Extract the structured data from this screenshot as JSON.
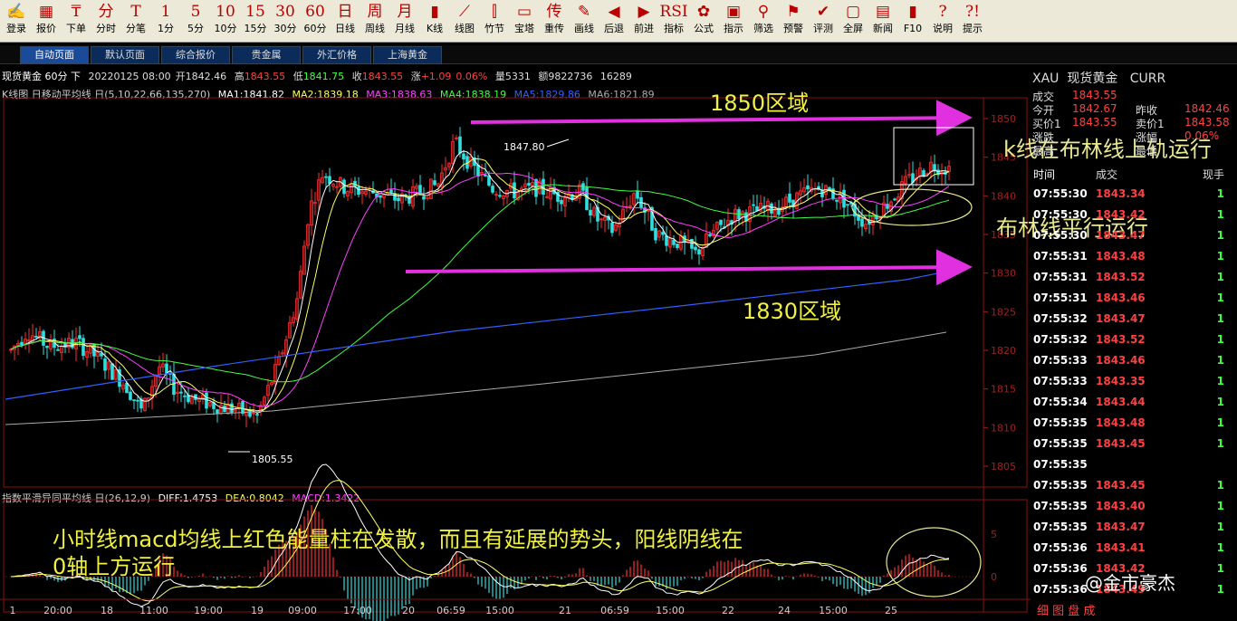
{
  "toolbar": {
    "items": [
      {
        "icon": "✍",
        "label": "登录"
      },
      {
        "icon": "▦",
        "label": "报价"
      },
      {
        "icon": "₸",
        "label": "下单"
      },
      {
        "icon": "分",
        "label": "分时"
      },
      {
        "icon": "T",
        "label": "分笔"
      },
      {
        "icon": "1",
        "label": "1分"
      },
      {
        "icon": "5",
        "label": "5分"
      },
      {
        "icon": "10",
        "label": "10分"
      },
      {
        "icon": "15",
        "label": "15分"
      },
      {
        "icon": "30",
        "label": "30分"
      },
      {
        "icon": "60",
        "label": "60分"
      },
      {
        "icon": "日",
        "label": "日线"
      },
      {
        "icon": "周",
        "label": "周线"
      },
      {
        "icon": "月",
        "label": "月线"
      },
      {
        "icon": "▮",
        "label": "K线"
      },
      {
        "icon": "⟋",
        "label": "线图"
      },
      {
        "icon": "⫿",
        "label": "竹节"
      },
      {
        "icon": "▭",
        "label": "宝塔"
      },
      {
        "icon": "传",
        "label": "重传"
      },
      {
        "icon": "✎",
        "label": "画线"
      },
      {
        "icon": "◀",
        "label": "后退"
      },
      {
        "icon": "▶",
        "label": "前进"
      },
      {
        "icon": "RSI",
        "label": "指标"
      },
      {
        "icon": "✿",
        "label": "公式"
      },
      {
        "icon": "▣",
        "label": "指示"
      },
      {
        "icon": "⚲",
        "label": "筛选"
      },
      {
        "icon": "⚑",
        "label": "预警"
      },
      {
        "icon": "✔",
        "label": "评测"
      },
      {
        "icon": "▢",
        "label": "全屏"
      },
      {
        "icon": "▤",
        "label": "新闻"
      },
      {
        "icon": "▮",
        "label": "F10"
      },
      {
        "icon": "?",
        "label": "说明"
      },
      {
        "icon": "?!",
        "label": "提示"
      }
    ]
  },
  "tabs": [
    "自动页面",
    "默认页面",
    "综合报价",
    "贵金属",
    "外汇价格",
    "上海黄金"
  ],
  "info": {
    "title": "现货黄金 60分 下",
    "date": "20220125 08:00",
    "open": "开1842.46",
    "high_label": "高",
    "high": "1843.55",
    "low_label": "低",
    "low": "1841.75",
    "close_label": "收",
    "close": "1843.55",
    "change_label": "涨",
    "change": "+1.09",
    "change_pct": "0.06%",
    "volume": "量5331",
    "amount": "额9822736",
    "extra": "16289"
  },
  "ma": {
    "title": "K线图 日移动平均线 日(5,10,22,66,135,270)",
    "ma1": "MA1:1841.82",
    "ma2": "MA2:1839.18",
    "ma3": "MA3:1838.63",
    "ma4": "MA4:1838.19",
    "ma5": "MA5:1829.86",
    "ma6": "MA6:1821.89"
  },
  "macd": {
    "title": "指数平滑异同平均线 日(26,12,9)",
    "diff": "DIFF:1.4753",
    "dea": "DEA:0.8042",
    "macd": "MACD:1.3422"
  },
  "annotations": {
    "zone1850": "1850区域",
    "zone1830": "1830区域",
    "upper_rail": "k线在布林线上轨运行",
    "boll_flat": "布林线平行运行",
    "macd_note_line1": "小时线macd均线上红色能量柱在发散，而且有延展的势头，阳线阴线在",
    "macd_note_line2": "0轴上方运行"
  },
  "chart_data": {
    "type": "candlestick",
    "title": "现货黄金 60分",
    "price_axis": {
      "min": 1805,
      "max": 1850,
      "ticks": [
        1850,
        1845,
        1840,
        1835,
        1830,
        1825,
        1820,
        1815,
        1810,
        1805
      ]
    },
    "macd_axis": {
      "ticks": [
        5,
        0
      ]
    },
    "x_ticks": [
      "1",
      "20:00",
      "18",
      "11:00",
      "19:00",
      "19",
      "09:00",
      "17:00",
      "20",
      "06:59",
      "15:00",
      "21",
      "06:59",
      "15:00",
      "22",
      "24",
      "15:00",
      "25"
    ],
    "labels": {
      "high": "1847.80",
      "low": "1805.55"
    },
    "last_close": 1843.55,
    "colors": {
      "up": "#ff3030",
      "down": "#30e0e0",
      "ma1": "#ffffff",
      "ma2": "#ffff60",
      "ma3": "#ff40ff",
      "ma4": "#40ff40",
      "ma5": "#3060ff",
      "ma6": "#aaaaaa",
      "zone_arrow": "#e030e0"
    }
  },
  "quote": {
    "symbol": "XAU",
    "name": "现货黄金",
    "curr": "CURR",
    "rows": [
      {
        "label": "成交",
        "value": "1843.55"
      },
      {
        "label": "今开",
        "value": "1842.67",
        "label2": "昨收",
        "value2": "1842.46"
      },
      {
        "label": "买价1",
        "value": "1843.55",
        "label2": "卖价1",
        "value2": "1843.58"
      },
      {
        "label": "涨跌",
        "value": "",
        "label2": "涨幅",
        "value2": "0.06%"
      },
      {
        "label": "最高",
        "value": "",
        "label2": "最低",
        "value2": ""
      }
    ]
  },
  "ticks_header": {
    "time": "时间",
    "price": "成交",
    "vol": "现手"
  },
  "ticks": [
    {
      "t": "07:55:30",
      "p": "1843.34",
      "v": "1"
    },
    {
      "t": "07:55:30",
      "p": "1843.42",
      "v": "1"
    },
    {
      "t": "07:55:30",
      "p": "1843.47",
      "v": "1"
    },
    {
      "t": "07:55:31",
      "p": "1843.48",
      "v": "1"
    },
    {
      "t": "07:55:31",
      "p": "1843.52",
      "v": "1"
    },
    {
      "t": "07:55:31",
      "p": "1843.46",
      "v": "1"
    },
    {
      "t": "07:55:32",
      "p": "1843.47",
      "v": "1"
    },
    {
      "t": "07:55:32",
      "p": "1843.52",
      "v": "1"
    },
    {
      "t": "07:55:33",
      "p": "1843.46",
      "v": "1"
    },
    {
      "t": "07:55:33",
      "p": "1843.35",
      "v": "1"
    },
    {
      "t": "07:55:34",
      "p": "1843.44",
      "v": "1"
    },
    {
      "t": "07:55:35",
      "p": "1843.48",
      "v": "1"
    },
    {
      "t": "07:55:35",
      "p": "1843.45",
      "v": "1"
    },
    {
      "t": "07:55:35",
      "p": "",
      "v": ""
    },
    {
      "t": "07:55:35",
      "p": "1843.45",
      "v": "1"
    },
    {
      "t": "07:55:35",
      "p": "1843.40",
      "v": "1"
    },
    {
      "t": "07:55:35",
      "p": "1843.47",
      "v": "1"
    },
    {
      "t": "07:55:36",
      "p": "1843.41",
      "v": "1"
    },
    {
      "t": "07:55:36",
      "p": "1843.42",
      "v": "1"
    },
    {
      "t": "07:55:36",
      "p": "1843.49",
      "v": "1"
    }
  ],
  "bottom_tabs": "细  图  盘  成",
  "watermark": "@金市豪杰"
}
